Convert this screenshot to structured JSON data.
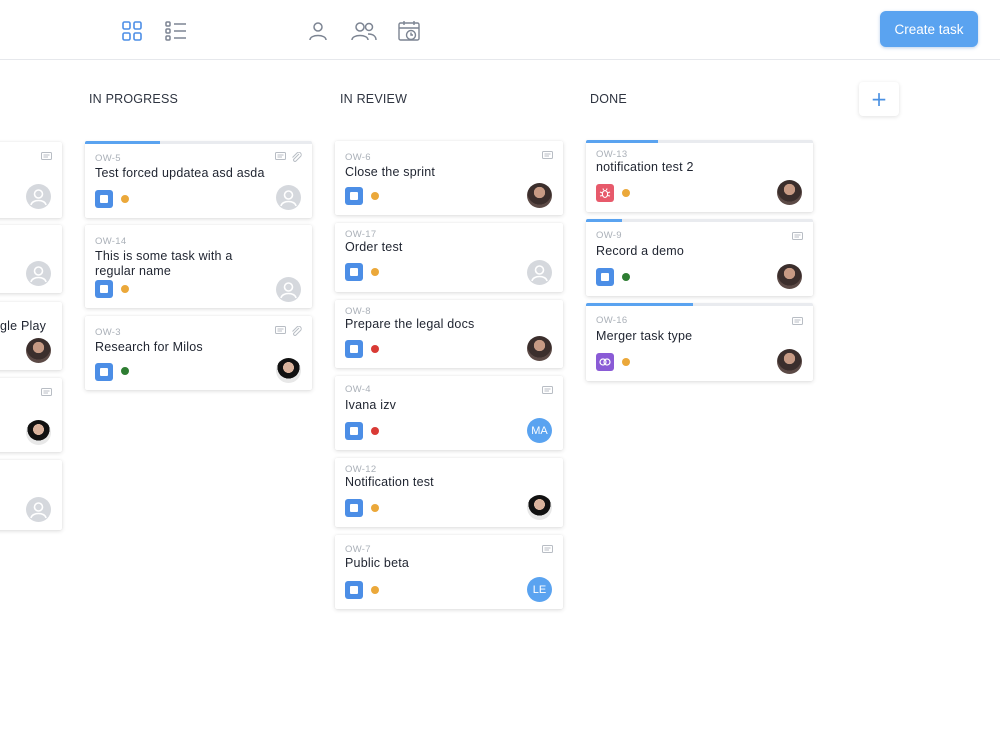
{
  "toolbar": {
    "create_task_label": "Create task",
    "icons": [
      "board-view-icon",
      "list-view-icon",
      "user-icon",
      "team-icon",
      "calendar-clock-icon"
    ]
  },
  "colors": {
    "accent": "#5aa3f0",
    "priority_medium": "#eba83a",
    "priority_high": "#d93a35",
    "priority_low": "#2e7d32"
  },
  "columns": {
    "left_partial": {
      "cards": [
        {
          "title": "",
          "assignee": "empty"
        },
        {
          "title": "",
          "assignee": "empty"
        },
        {
          "title": "gle Play",
          "assignee": "photo"
        },
        {
          "title": "",
          "assignee": "photo"
        },
        {
          "title": "",
          "assignee": "empty"
        }
      ]
    },
    "in_progress": {
      "title": "IN PROGRESS",
      "cards": [
        {
          "key": "OW-5",
          "title": "Test forced updatea asd asda",
          "priority": "medium",
          "assignee": "empty",
          "progress": 0.33
        },
        {
          "key": "OW-14",
          "title": "This is some task with a regular name",
          "priority": "medium",
          "assignee": "empty"
        },
        {
          "key": "OW-3",
          "title": "Research for Milos",
          "priority": "low",
          "assignee": "photo"
        }
      ]
    },
    "in_review": {
      "title": "IN REVIEW",
      "cards": [
        {
          "key": "OW-6",
          "title": "Close the sprint",
          "priority": "medium",
          "assignee": "photo"
        },
        {
          "key": "OW-17",
          "title": "Order test",
          "priority": "medium",
          "assignee": "empty"
        },
        {
          "key": "OW-8",
          "title": "Prepare the legal docs",
          "priority": "high",
          "assignee": "photo"
        },
        {
          "key": "OW-4",
          "title": "Ivana izv",
          "priority": "high",
          "assignee": "MA"
        },
        {
          "key": "OW-12",
          "title": "Notification test",
          "priority": "medium",
          "assignee": "photo"
        },
        {
          "key": "OW-7",
          "title": "Public beta",
          "priority": "medium",
          "assignee": "LE"
        }
      ]
    },
    "done": {
      "title": "DONE",
      "cards": [
        {
          "key": "OW-13",
          "title": "notification test 2",
          "priority": "medium",
          "assignee": "photo",
          "type": "bug",
          "progress": 0.32
        },
        {
          "key": "OW-9",
          "title": "Record a demo",
          "priority": "low",
          "assignee": "photo",
          "progress": 0.16
        },
        {
          "key": "OW-16",
          "title": "Merger task type",
          "priority": "medium",
          "assignee": "photo",
          "type": "merge",
          "progress": 0.47
        }
      ]
    }
  }
}
